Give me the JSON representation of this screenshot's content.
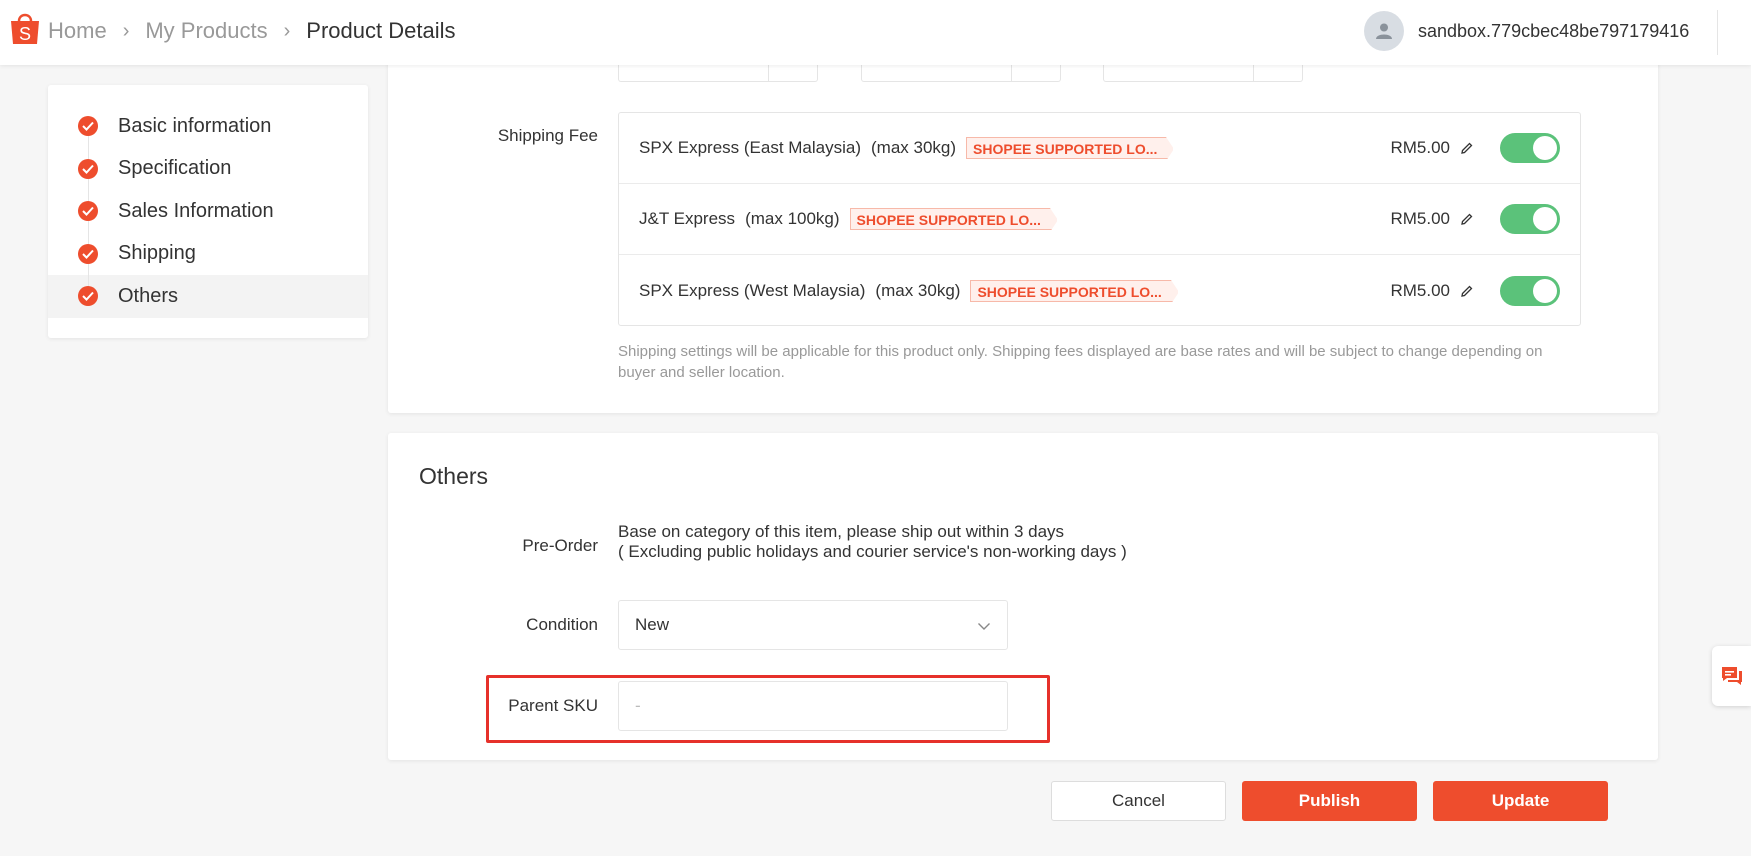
{
  "header": {
    "breadcrumbs": [
      "Home",
      "My Products",
      "Product Details"
    ],
    "username": "sandbox.779cbec48be797179416"
  },
  "sidebar": {
    "items": [
      {
        "label": "Basic information",
        "done": true
      },
      {
        "label": "Specification",
        "done": true
      },
      {
        "label": "Sales Information",
        "done": true
      },
      {
        "label": "Shipping",
        "done": true
      },
      {
        "label": "Others",
        "done": true,
        "active": true
      }
    ]
  },
  "shipping": {
    "label": "Shipping Fee",
    "channels": [
      {
        "name": "SPX Express (East Malaysia)",
        "max": "(max 30kg)",
        "tag": "SHOPEE SUPPORTED LO...",
        "price": "RM5.00",
        "enabled": true
      },
      {
        "name": "J&T Express",
        "max": "(max 100kg)",
        "tag": "SHOPEE SUPPORTED LO...",
        "price": "RM5.00",
        "enabled": true
      },
      {
        "name": "SPX Express (West Malaysia)",
        "max": "(max 30kg)",
        "tag": "SHOPEE SUPPORTED LO...",
        "price": "RM5.00",
        "enabled": true
      }
    ],
    "note": "Shipping settings will be applicable for this product only. Shipping fees displayed are base rates and will be subject to change depending on buyer and seller location."
  },
  "others": {
    "title": "Others",
    "preorder_label": "Pre-Order",
    "preorder_line1": "Base on category of this item, please ship out within 3 days",
    "preorder_line2": "( Excluding public holidays and courier service's non-working days )",
    "condition_label": "Condition",
    "condition_value": "New",
    "parent_sku_label": "Parent SKU",
    "parent_sku_placeholder": "-",
    "parent_sku_value": ""
  },
  "actions": {
    "cancel": "Cancel",
    "publish": "Publish",
    "update": "Update"
  },
  "colors": {
    "brand": "#ee4d2d",
    "toggle_on": "#5bc27a",
    "highlight": "#e6312a"
  }
}
